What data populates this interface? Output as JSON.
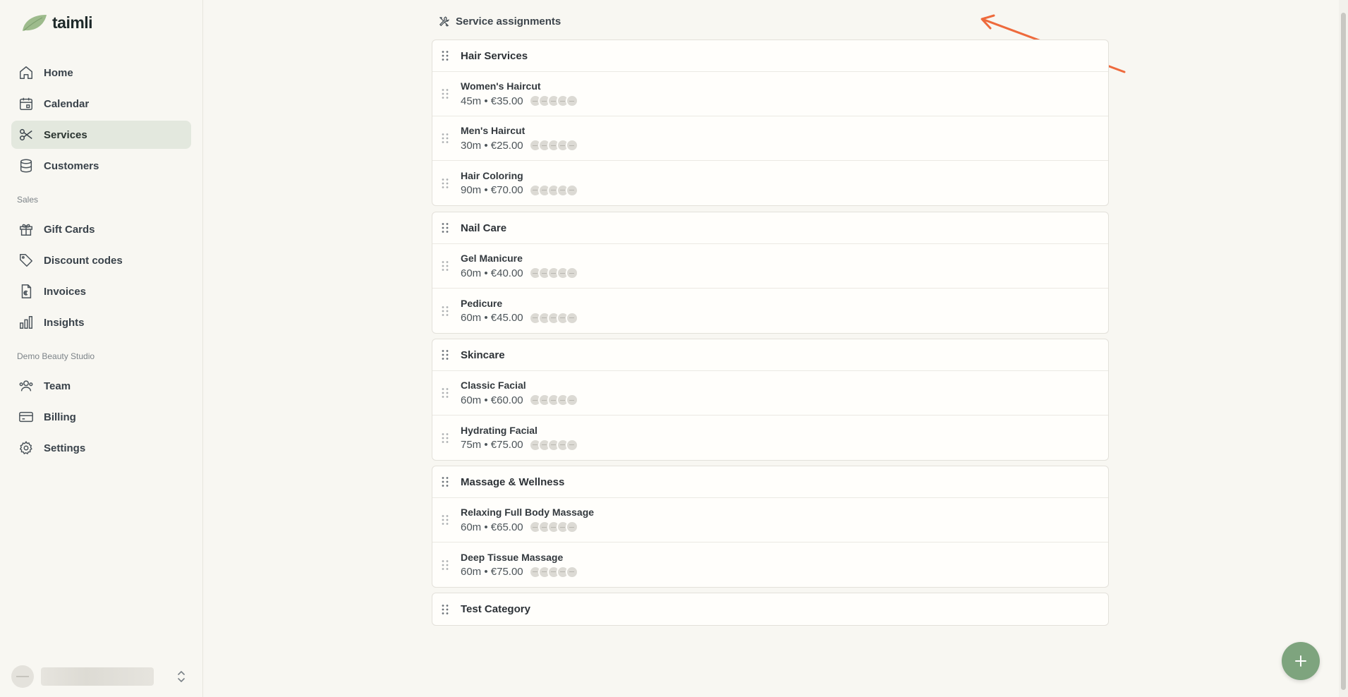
{
  "brand": {
    "name": "taimli"
  },
  "nav": {
    "primary": [
      {
        "label": "Home",
        "icon": "home-icon"
      },
      {
        "label": "Calendar",
        "icon": "calendar-icon"
      },
      {
        "label": "Services",
        "icon": "scissors-icon",
        "active": true
      },
      {
        "label": "Customers",
        "icon": "database-icon"
      }
    ],
    "sales_title": "Sales",
    "sales": [
      {
        "label": "Gift Cards",
        "icon": "gift-icon"
      },
      {
        "label": "Discount codes",
        "icon": "tag-icon"
      },
      {
        "label": "Invoices",
        "icon": "euro-document-icon"
      },
      {
        "label": "Insights",
        "icon": "bar-chart-icon"
      }
    ],
    "studio_title": "Demo Beauty Studio",
    "studio": [
      {
        "label": "Team",
        "icon": "users-icon"
      },
      {
        "label": "Billing",
        "icon": "credit-card-icon"
      },
      {
        "label": "Settings",
        "icon": "gear-icon"
      }
    ]
  },
  "header": {
    "title": "Service assignments",
    "icon": "tools-icon"
  },
  "categories": [
    {
      "name": "Hair Services",
      "services": [
        {
          "name": "Women's Haircut",
          "meta": "45m • €35.00"
        },
        {
          "name": "Men's Haircut",
          "meta": "30m • €25.00"
        },
        {
          "name": "Hair Coloring",
          "meta": "90m • €70.00"
        }
      ]
    },
    {
      "name": "Nail Care",
      "services": [
        {
          "name": "Gel Manicure",
          "meta": "60m • €40.00"
        },
        {
          "name": "Pedicure",
          "meta": "60m • €45.00"
        }
      ]
    },
    {
      "name": "Skincare",
      "services": [
        {
          "name": "Classic Facial",
          "meta": "60m • €60.00"
        },
        {
          "name": "Hydrating Facial",
          "meta": "75m • €75.00"
        }
      ]
    },
    {
      "name": "Massage & Wellness",
      "services": [
        {
          "name": "Relaxing Full Body Massage",
          "meta": "60m • €65.00"
        },
        {
          "name": "Deep Tissue Massage",
          "meta": "60m • €75.00"
        }
      ]
    },
    {
      "name": "Test Category",
      "services": []
    }
  ],
  "colors": {
    "accent": "#7ea47e",
    "active_nav": "#e3e8de",
    "annotation_arrow": "#ee6a3c",
    "background": "#f8f7f2"
  }
}
